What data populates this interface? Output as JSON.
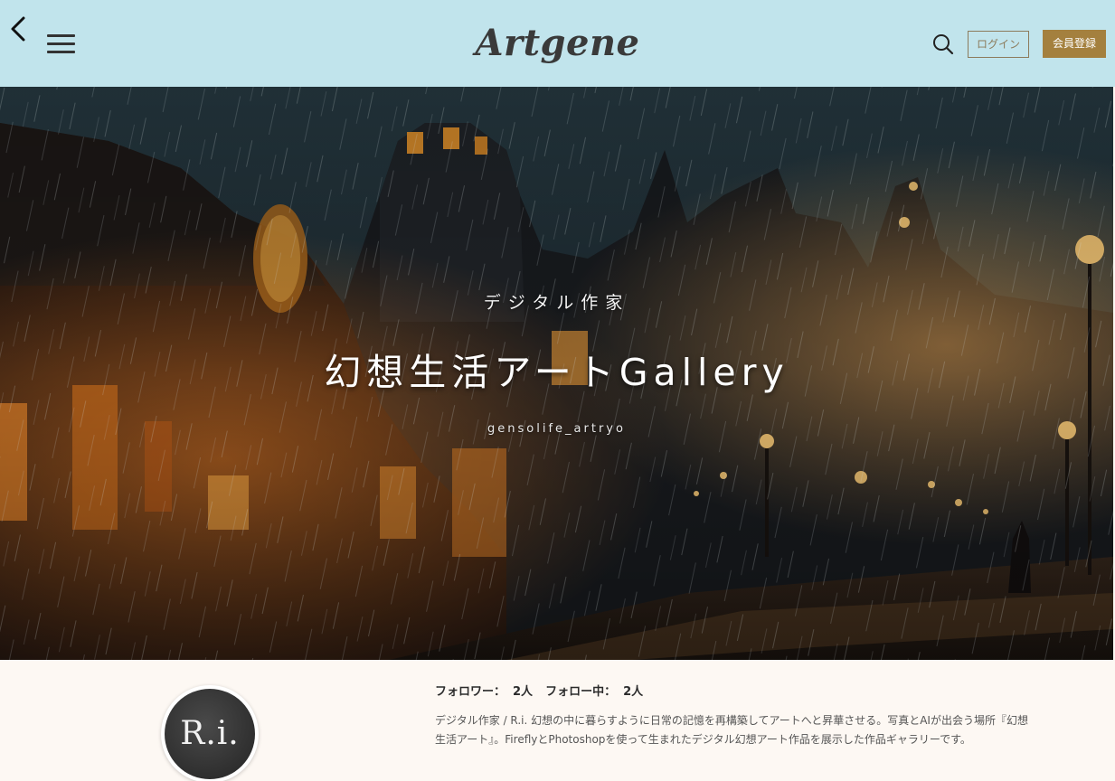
{
  "header": {
    "logo": "Artgene",
    "login_label": "ログイン",
    "signup_label": "会員登録",
    "icons": [
      "chevron-left-icon",
      "hamburger-menu-icon",
      "search-icon"
    ],
    "background_color": "#c1e4ec",
    "signup_color": "#a4803e"
  },
  "hero": {
    "category": "デジタル作家",
    "title": "幻想生活アートGallery",
    "handle": "gensolife_artryo"
  },
  "profile": {
    "avatar_text": "R.i.",
    "followers_label": "フォロワー：",
    "followers_count": "2人",
    "following_label": "フォロー中：",
    "following_count": "2人",
    "bio": "デジタル作家 / R.i. 幻想の中に暮らすように日常の記憶を再構築してアートへと昇華させる。写真とAIが出会う場所『幻想生活アート』。FireflyとPhotoshopを使って生まれたデジタル幻想アート作品を展示した作品ギャラリーです。"
  }
}
